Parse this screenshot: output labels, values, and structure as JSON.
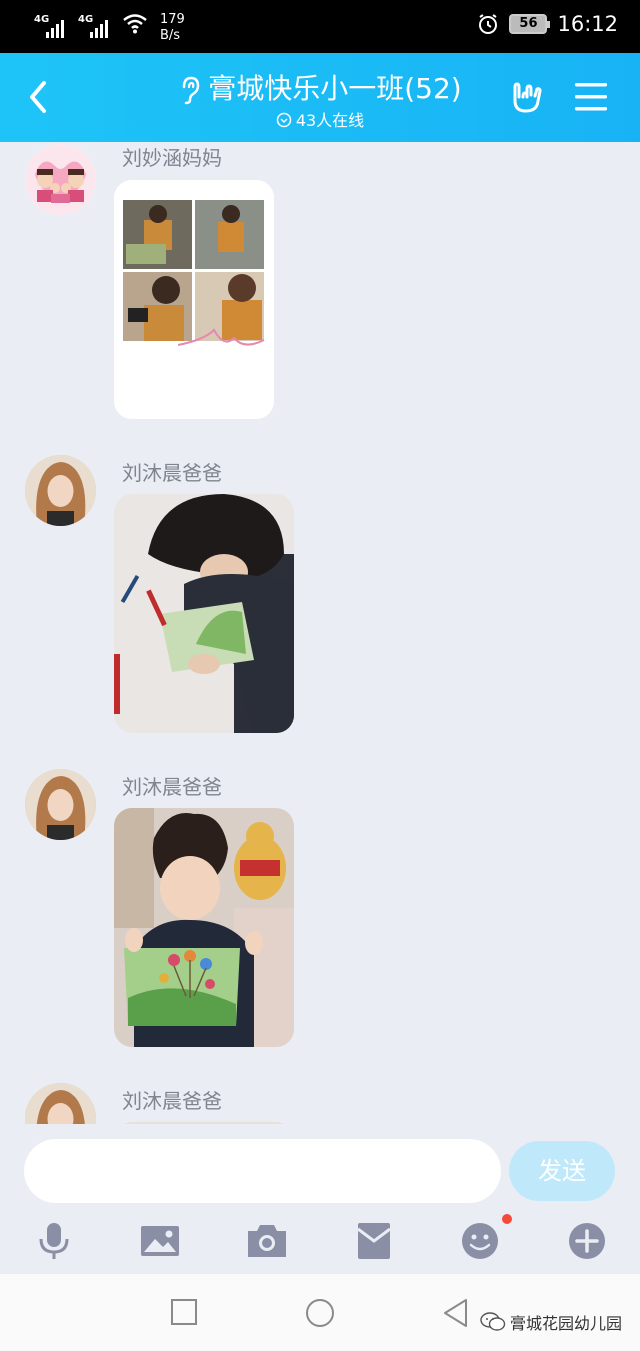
{
  "status_bar": {
    "network1": "4G",
    "network2": "4G",
    "speed_value": "179",
    "speed_unit": "B/s",
    "battery": "56",
    "time": "16:12"
  },
  "header": {
    "title": "膏城快乐小一班(52)",
    "online": "43人在线"
  },
  "messages": [
    {
      "sender": "刘妙涵妈妈",
      "content": "photo-collage"
    },
    {
      "sender": "刘沐晨爸爸",
      "content": "photo-drawing"
    },
    {
      "sender": "刘沐晨爸爸",
      "content": "photo-holding-drawing"
    },
    {
      "sender": "刘沐晨爸爸",
      "content": "photo-partial"
    }
  ],
  "input": {
    "value": "",
    "send_label": "发送"
  },
  "toolbar": {
    "icons": [
      "microphone-icon",
      "image-icon",
      "camera-icon",
      "red-packet-icon",
      "emoji-icon",
      "plus-icon"
    ],
    "emoji_badge_color": "#f44a3a"
  },
  "watermark": "膏城花园幼儿园",
  "colors": {
    "header_start": "#1ec4f7",
    "header_end": "#18b3f5",
    "chat_bg": "#eaedf4",
    "send_disabled": "#bfe9fb"
  }
}
